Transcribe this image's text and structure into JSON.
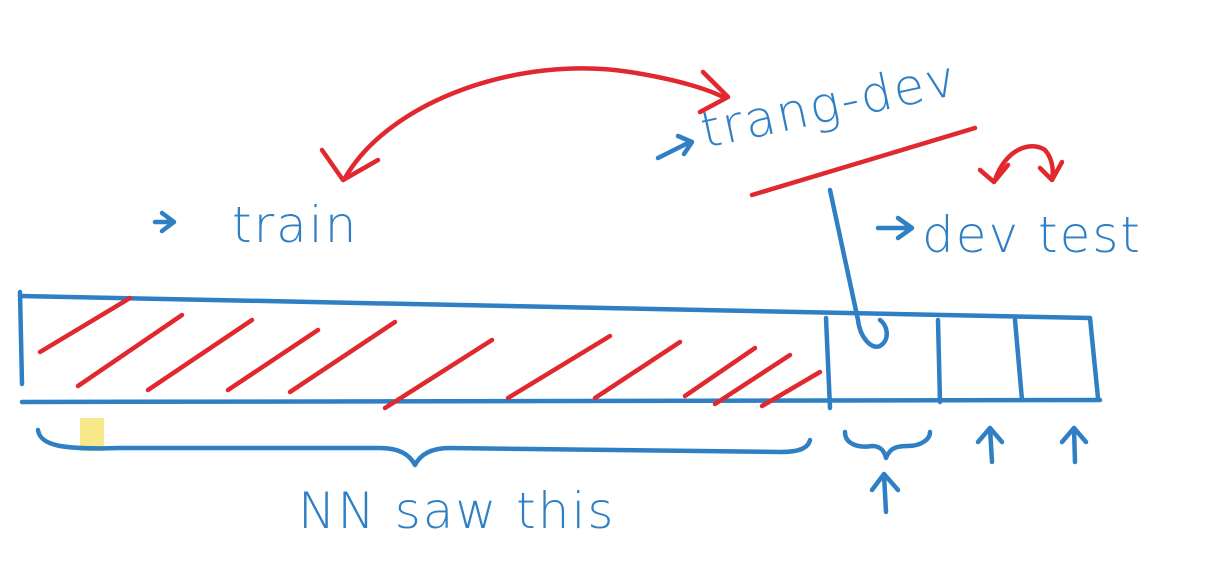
{
  "labels": {
    "train": "train",
    "train_dev": "trang-dev",
    "dev_test": "dev test",
    "nn_saw_this": "NN saw this"
  },
  "colors": {
    "ink_blue": "#2f7fc4",
    "ink_red": "#e0282e",
    "highlight": "#f7e98a",
    "background": "#ffffff"
  }
}
